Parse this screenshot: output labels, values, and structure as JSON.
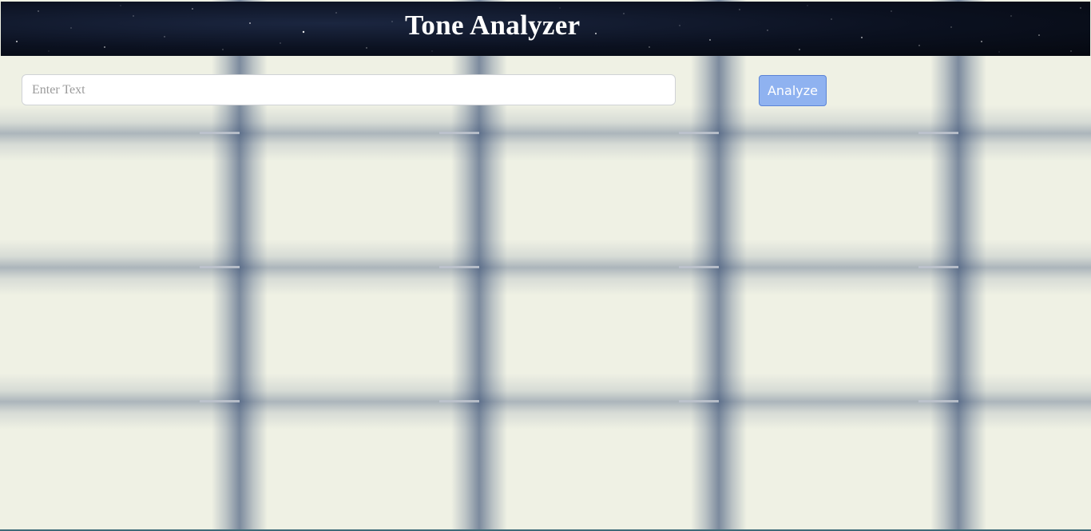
{
  "header": {
    "title": "Tone Analyzer"
  },
  "form": {
    "input_placeholder": "Enter Text",
    "input_value": "",
    "button_label": "Analyze"
  },
  "colors": {
    "header_bg": "#0b1120",
    "button_bg": "#8fb2f0",
    "page_bg": "#eff1e4"
  }
}
